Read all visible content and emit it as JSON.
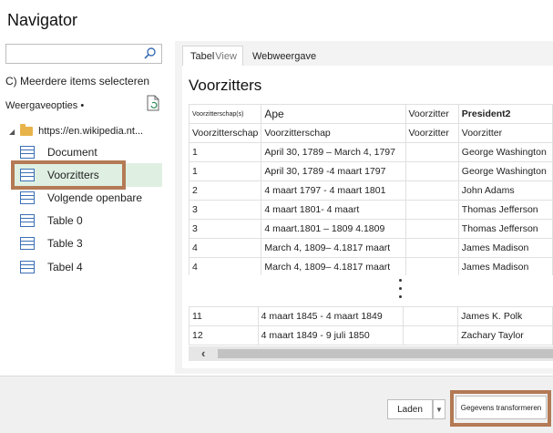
{
  "window": {
    "title": "Navigator"
  },
  "left": {
    "search_placeholder": "",
    "multi_select": "C) Meerdere items selecteren",
    "view_options": "Weergaveopties •",
    "root": "https://en.wikipedia.nt...",
    "items": [
      "Document",
      "Voorzitters",
      "Volgende openbare",
      "Table 0",
      "Table 3",
      "Tabel 4"
    ],
    "selected_index": 1
  },
  "tabs": {
    "tabel": "Tabel",
    "view": "View",
    "web": "Webweergave"
  },
  "preview": {
    "title": "Voorzitters",
    "headers": [
      "Voorzitterschap(s)",
      "Ape",
      "Voorzitter",
      "President2"
    ],
    "rows": [
      [
        "Voorzitterschap",
        "Voorzitterschap",
        "Voorzitter",
        "Voorzitter"
      ],
      [
        "1",
        "April 30, 1789 – March 4, 1797",
        "",
        "George Washington"
      ],
      [
        "1",
        "April 30, 1789 -4 maart 1797",
        "",
        "George Washington"
      ],
      [
        "2",
        "4 maart 1797 -   4 maart 1801",
        "",
        "John Adams"
      ],
      [
        "3",
        "4 maart 1801-   4 maart",
        "",
        "Thomas Jefferson"
      ],
      [
        "3",
        "4 maart.1801 –   1809 4.1809",
        "",
        "Thomas Jefferson"
      ],
      [
        "4",
        "March 4, 1809– 4.1817 maart",
        "",
        "James Madison"
      ],
      [
        "4",
        "March 4, 1809– 4.1817 maart",
        "",
        "James Madison"
      ]
    ],
    "rows2": [
      [
        "11",
        "4 maart 1845 -   4 maart 1849",
        "",
        "James K. Polk"
      ],
      [
        "12",
        "4 maart 1849 - 9 juli 1850",
        "",
        "Zachary  Taylor"
      ]
    ]
  },
  "footer": {
    "load": "Laden",
    "transform": "Gegevens transformeren"
  }
}
